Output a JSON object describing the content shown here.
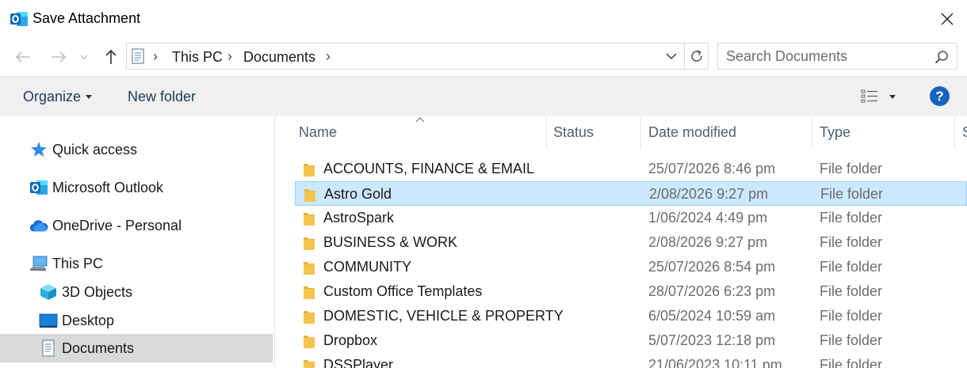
{
  "window": {
    "title": "Save Attachment"
  },
  "address": {
    "crumbs": [
      "This PC",
      "Documents"
    ]
  },
  "search": {
    "placeholder": "Search Documents"
  },
  "toolbar": {
    "organize_label": "Organize",
    "new_folder_label": "New folder",
    "help_label": "?"
  },
  "sidebar": {
    "items": [
      {
        "label": "Quick access",
        "icon": "star-icon"
      },
      {
        "label": "Microsoft Outlook",
        "icon": "outlook-icon"
      },
      {
        "label": "OneDrive - Personal",
        "icon": "cloud-icon"
      },
      {
        "label": "This PC",
        "icon": "computer-icon"
      },
      {
        "label": "3D Objects",
        "icon": "cube-icon"
      },
      {
        "label": "Desktop",
        "icon": "desktop-icon"
      },
      {
        "label": "Documents",
        "icon": "document-icon"
      }
    ]
  },
  "columns": {
    "name": "Name",
    "status": "Status",
    "date_modified": "Date modified",
    "type": "Type",
    "size": "S"
  },
  "files": [
    {
      "name": "ACCOUNTS, FINANCE & EMAIL",
      "date": "25/07/2026 8:46 pm",
      "type": "File folder"
    },
    {
      "name": "Astro Gold",
      "date": "2/08/2026 9:27 pm",
      "type": "File folder"
    },
    {
      "name": "AstroSpark",
      "date": "1/06/2024 4:49 pm",
      "type": "File folder"
    },
    {
      "name": "BUSINESS & WORK",
      "date": "2/08/2026 9:27 pm",
      "type": "File folder"
    },
    {
      "name": "COMMUNITY",
      "date": "25/07/2026 8:54 pm",
      "type": "File folder"
    },
    {
      "name": "Custom Office Templates",
      "date": "28/07/2026 6:23 pm",
      "type": "File folder"
    },
    {
      "name": "DOMESTIC, VEHICLE & PROPERTY",
      "date": "6/05/2024 10:59 am",
      "type": "File folder"
    },
    {
      "name": "Dropbox",
      "date": "5/07/2023 12:18 pm",
      "type": "File folder"
    },
    {
      "name": "DSSPlayer",
      "date": "21/06/2023 10:11 pm",
      "type": "File folder"
    }
  ],
  "colors": {
    "selection_bg": "#cce8ff",
    "selection_border": "#99d1ff",
    "folder_yellow": "#f5c44f",
    "outlook_blue": "#0f6cbd",
    "help_blue": "#1664c0"
  }
}
